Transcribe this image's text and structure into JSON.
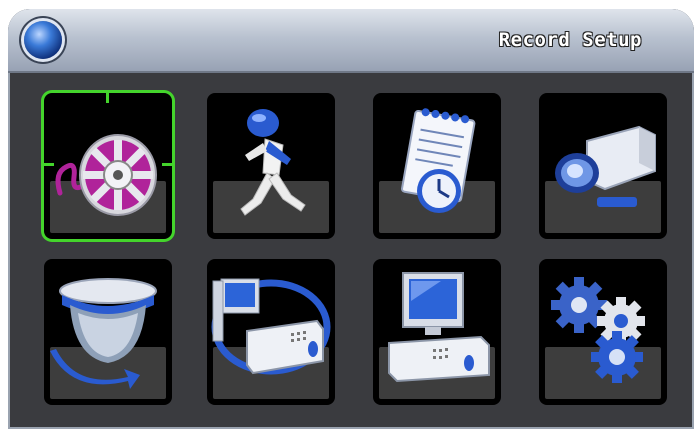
{
  "window": {
    "title": "Record Setup"
  },
  "tiles": [
    {
      "icon": "film-reel-icon",
      "selected": true
    },
    {
      "icon": "running-man-icon",
      "selected": false
    },
    {
      "icon": "schedule-notepad-clock-icon",
      "selected": false
    },
    {
      "icon": "camera-icon",
      "selected": false
    },
    {
      "icon": "dome-camera-icon",
      "selected": false
    },
    {
      "icon": "network-dvr-icon",
      "selected": false
    },
    {
      "icon": "computer-dvr-icon",
      "selected": false
    },
    {
      "icon": "gears-icon",
      "selected": false
    }
  ],
  "colors": {
    "selection": "#44d42c",
    "accent_blue": "#2a5bd0",
    "reel_magenta": "#b0239a"
  }
}
